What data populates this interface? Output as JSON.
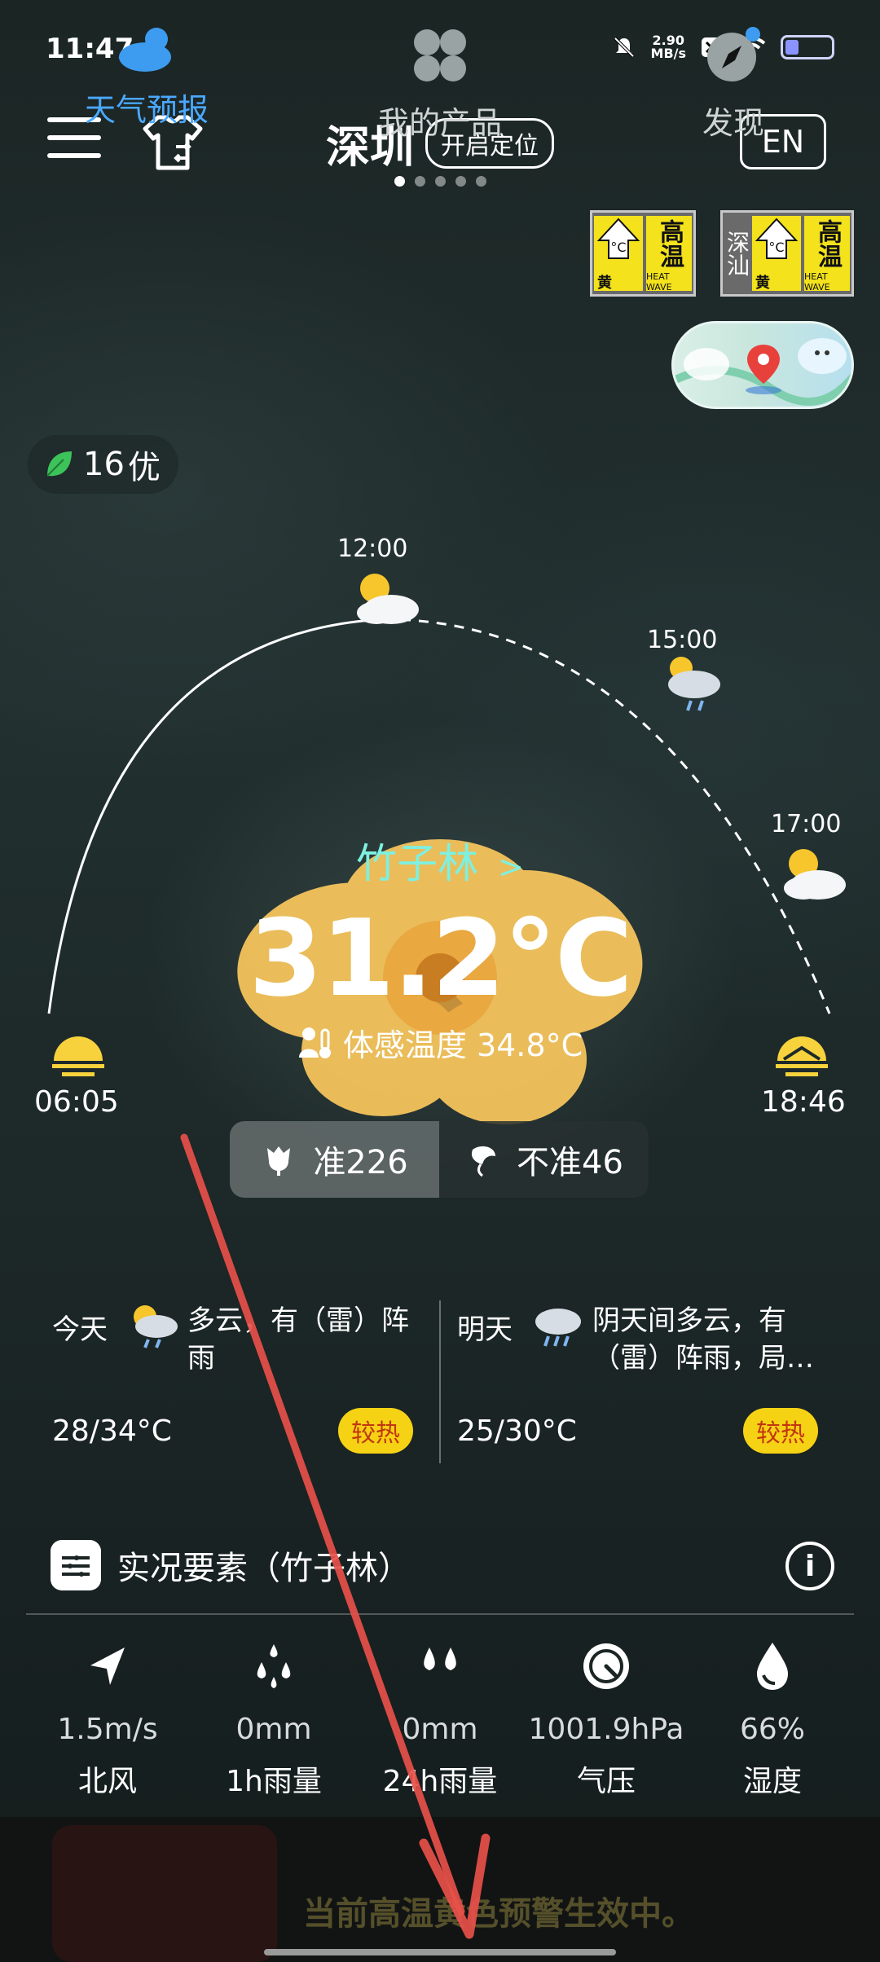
{
  "status_bar": {
    "time": "11:47",
    "net_speed_value": "2.90",
    "net_speed_unit": "MB/s"
  },
  "header": {
    "city": "深圳",
    "locate_label": "开启定位",
    "lang_button": "EN",
    "page_count": 5,
    "active_page": 0
  },
  "warnings": [
    {
      "level": "黄",
      "type_cn": "高温",
      "type_en": "HEAT WAVE",
      "city": ""
    },
    {
      "level": "黄",
      "type_cn": "高温",
      "type_en": "HEAT WAVE",
      "city": "深汕"
    }
  ],
  "aqi": {
    "value": "16",
    "level": "优"
  },
  "sun_arc": {
    "sunrise": "06:05",
    "sunset": "18:46",
    "hours": [
      {
        "time": "12:00",
        "icon": "partly-cloudy-icon"
      },
      {
        "time": "15:00",
        "icon": "rain-cloud-icon"
      },
      {
        "time": "17:00",
        "icon": "partly-cloudy-icon"
      }
    ]
  },
  "current": {
    "location": "竹子林",
    "location_arrow": ">",
    "temperature": "31.2°C",
    "feels_like": "体感温度 34.8°C"
  },
  "vote": {
    "accurate": "准226",
    "inaccurate": "不准46"
  },
  "forecast": [
    {
      "day": "今天",
      "desc": "多云，有（雷）阵雨",
      "temp": "28/34°C",
      "badge": "较热",
      "icon": "thunder-shower-icon"
    },
    {
      "day": "明天",
      "desc": "阴天间多云，有（雷）阵雨，局…",
      "temp": "25/30°C",
      "badge": "较热",
      "icon": "rain-icon"
    }
  ],
  "live": {
    "title": "实况要素（竹子林）",
    "items": [
      {
        "value": "1.5m/s",
        "label": "北风",
        "icon": "wind-direction-icon"
      },
      {
        "value": "0mm",
        "label": "1h雨量",
        "icon": "rain-drops-icon"
      },
      {
        "value": "0mm",
        "label": "24h雨量",
        "icon": "rain-drops-icon"
      },
      {
        "value": "1001.9hPa",
        "label": "气压",
        "icon": "pressure-gauge-icon"
      },
      {
        "value": "66%",
        "label": "湿度",
        "icon": "humidity-drop-icon"
      }
    ]
  },
  "bottom_nav": {
    "weather": "天气预报",
    "products": "我的产品",
    "discover": "发现",
    "banner": "当前高温黄色预警生效中。"
  },
  "colors": {
    "accent": "#4aa8ff",
    "badge_bg": "#f6d215",
    "badge_text": "#c1360e",
    "location": "#7ef0e0",
    "warning_yellow": "#f3e21c",
    "annotation_arrow": "#e8504a"
  }
}
